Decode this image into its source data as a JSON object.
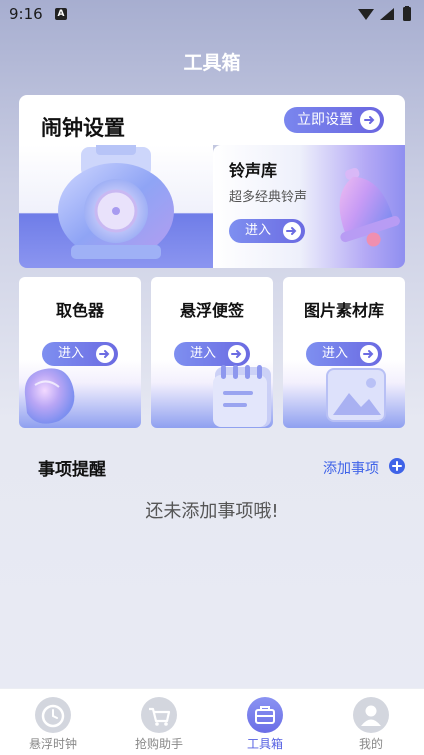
{
  "status_bar": {
    "time": "9:16",
    "notification_icon": "A"
  },
  "page": {
    "title": "工具箱"
  },
  "alarm_card": {
    "title": "闹钟设置",
    "button_label": "立即设置",
    "ringtone": {
      "title": "铃声库",
      "subtitle": "超多经典铃声",
      "button_label": "进入"
    }
  },
  "tools": [
    {
      "title": "取色器",
      "button_label": "进入",
      "icon": "color-picker-art"
    },
    {
      "title": "悬浮便签",
      "button_label": "进入",
      "icon": "notepad-art"
    },
    {
      "title": "图片素材库",
      "button_label": "进入",
      "icon": "image-library-art"
    }
  ],
  "reminders": {
    "title": "事项提醒",
    "add_label": "添加事项",
    "empty_text": "还未添加事项哦!"
  },
  "bottom_nav": [
    {
      "label": "悬浮时钟",
      "icon": "alarm-clock-icon",
      "active": false
    },
    {
      "label": "抢购助手",
      "icon": "cart-icon",
      "active": false
    },
    {
      "label": "工具箱",
      "icon": "toolbox-icon",
      "active": true
    },
    {
      "label": "我的",
      "icon": "profile-icon",
      "active": false
    }
  ],
  "colors": {
    "accent": "#6b6be2",
    "link": "#3f63e8",
    "active_nav": "#5560e2"
  }
}
